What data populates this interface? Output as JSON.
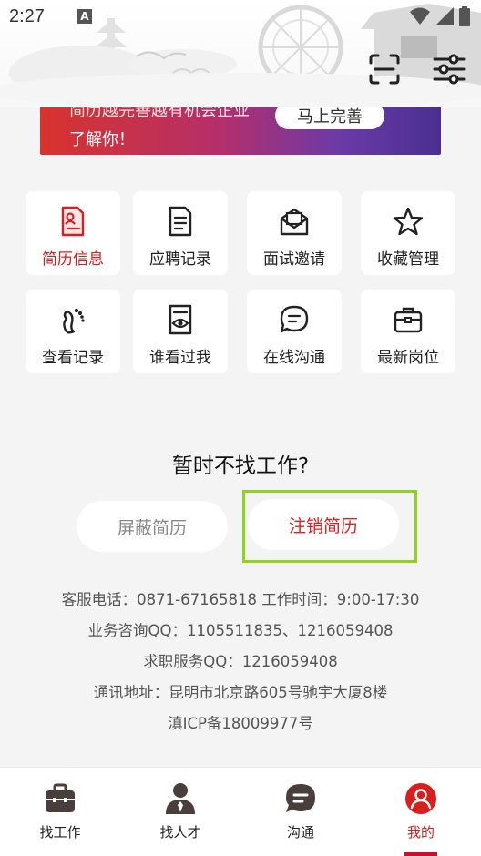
{
  "status_bar": {
    "time": "2:27",
    "a_badge": "A"
  },
  "header": {
    "scan_icon": "scan-icon",
    "filter_icon": "sliders-icon"
  },
  "banner": {
    "line1": "简历越完善越有机会企业",
    "line2": "了解你！",
    "button_label": "马上完善"
  },
  "grid": {
    "items": [
      {
        "label": "简历信息",
        "icon": "resume-icon",
        "active": true
      },
      {
        "label": "应聘记录",
        "icon": "document-icon"
      },
      {
        "label": "面试邀请",
        "icon": "envelope-icon"
      },
      {
        "label": "收藏管理",
        "icon": "star-icon"
      },
      {
        "label": "查看记录",
        "icon": "footprint-icon"
      },
      {
        "label": "谁看过我",
        "icon": "eye-icon"
      },
      {
        "label": "在线沟通",
        "icon": "chat-icon"
      },
      {
        "label": "最新岗位",
        "icon": "briefcase-icon"
      }
    ]
  },
  "pause": {
    "title": "暂时不找工作?",
    "hide_label": "屏蔽简历",
    "cancel_label": "注销简历"
  },
  "info": {
    "phone": "客服电话：0871-67165818 工作时间：9:00-17:30",
    "business_qq": "业务咨询QQ：1105511835、1216059408",
    "job_qq": "求职服务QQ：1216059408",
    "address": "通讯地址：昆明市北京路605号驰宇大厦8楼",
    "icp": "滇ICP备18009977号"
  },
  "nav": {
    "items": [
      {
        "label": "找工作",
        "icon": "briefcase-icon"
      },
      {
        "label": "找人才",
        "icon": "person-icon"
      },
      {
        "label": "沟通",
        "icon": "chat-icon"
      },
      {
        "label": "我的",
        "icon": "user-icon",
        "active": true
      }
    ]
  },
  "colors": {
    "accent": "#d81e1e",
    "highlight": "#8fd31c",
    "nav_icon": "#4a3e3c"
  }
}
